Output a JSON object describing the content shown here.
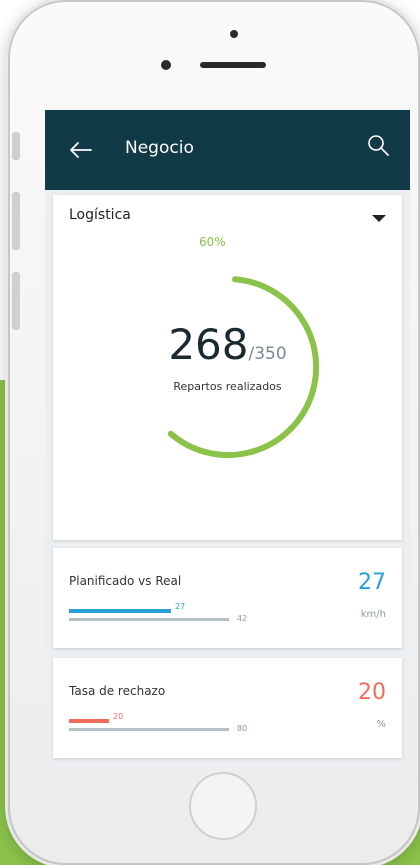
{
  "appbar": {
    "title": "Negocio",
    "back_icon": "arrow-left-icon",
    "search_icon": "search-icon",
    "color": "#113a47"
  },
  "summary": {
    "dropdown_label": "Logística",
    "percent_label": "60%",
    "progress_fraction": 0.6,
    "done": "268",
    "total": "/350",
    "caption": "Repartos realizados",
    "ring_color": "#8bc34a"
  },
  "kpis": [
    {
      "title": "Planificado vs Real",
      "value": "27",
      "unit": "km/h",
      "bar_value": "27",
      "bar_max": "42",
      "fraction": 0.64,
      "color": "#2a9fd8"
    },
    {
      "title": "Tasa de rechazo",
      "value": "20",
      "unit": "%",
      "bar_value": "20",
      "bar_max": "80",
      "fraction": 0.25,
      "color": "#f26b5b"
    }
  ]
}
